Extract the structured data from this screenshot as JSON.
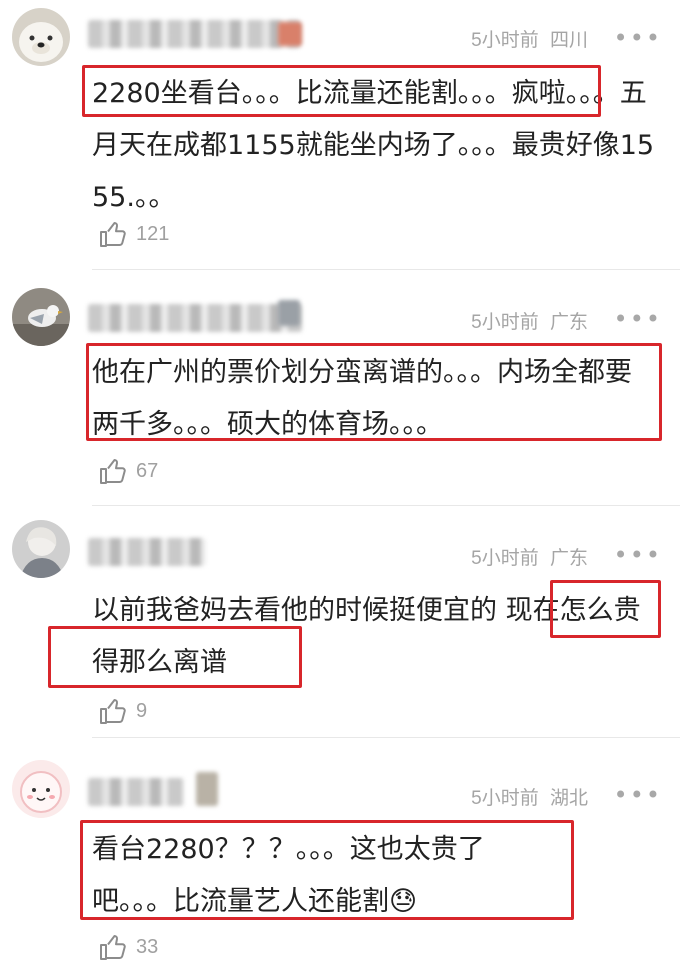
{
  "comments": [
    {
      "time": "5小时前",
      "location": "四川",
      "text": "2280坐看台。。。比流量还能割。。。疯啦。。。五月天在成都1155就能坐内场了。。。最贵好像1555.。。",
      "likes": "121"
    },
    {
      "time": "5小时前",
      "location": "广东",
      "text": "他在广州的票价划分蛮离谱的。。。内场全都要两千多。。。硕大的体育场。。。",
      "likes": "67"
    },
    {
      "time": "5小时前",
      "location": "广东",
      "text": "以前我爸妈去看他的时候挺便宜的 现在怎么贵得那么离谱",
      "likes": "9"
    },
    {
      "time": "5小时前",
      "location": "湖北",
      "text": "看台2280？？？。。。这也太贵了吧。。。比流量艺人还能割😓",
      "likes": "33"
    }
  ],
  "more_glyph": "•••",
  "highlight_color": "#d8262b"
}
